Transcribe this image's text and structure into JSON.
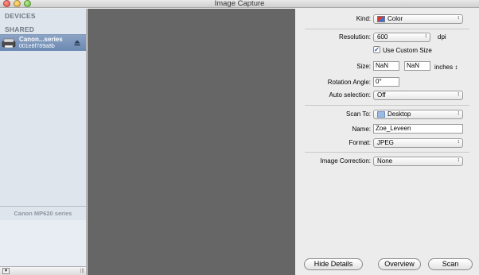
{
  "window": {
    "title": "Image Capture"
  },
  "sidebar": {
    "devices_heading": "DEVICES",
    "shared_heading": "SHARED",
    "selected_device": {
      "name": "Canon...series",
      "id": "001e8f789a8b"
    },
    "device_label": "Canon MP620 series"
  },
  "details": {
    "kind": {
      "label": "Kind:",
      "value": "Color"
    },
    "resolution": {
      "label": "Resolution:",
      "value": "600",
      "unit": "dpi"
    },
    "custom_size": {
      "label": "Use Custom Size",
      "checked": true
    },
    "size": {
      "label": "Size:",
      "width": "NaN",
      "height": "NaN",
      "unit": "inches"
    },
    "rotation": {
      "label": "Rotation Angle:",
      "value": "0°"
    },
    "auto_selection": {
      "label": "Auto selection:",
      "value": "Off"
    },
    "scan_to": {
      "label": "Scan To:",
      "value": "Desktop"
    },
    "name": {
      "label": "Name:",
      "value": "Zoe_Leveen"
    },
    "format": {
      "label": "Format:",
      "value": "JPEG"
    },
    "image_correction": {
      "label": "Image Correction:",
      "value": "None"
    }
  },
  "buttons": {
    "hide_details": "Hide Details",
    "overview": "Overview",
    "scan": "Scan"
  }
}
